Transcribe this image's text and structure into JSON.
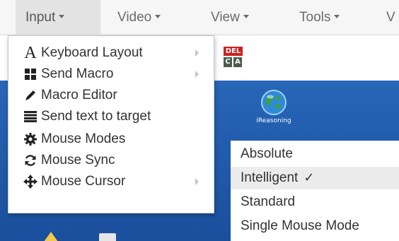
{
  "menubar": {
    "items": [
      {
        "label": "Input"
      },
      {
        "label": "Video"
      },
      {
        "label": "View"
      },
      {
        "label": "Tools"
      },
      {
        "label": "V"
      }
    ]
  },
  "input_menu": {
    "items": [
      {
        "label": "Keyboard Layout",
        "icon": "letter-a-icon",
        "has_submenu": true
      },
      {
        "label": "Send Macro",
        "icon": "grid-icon",
        "has_submenu": true
      },
      {
        "label": "Macro Editor",
        "icon": "pencil-icon",
        "has_submenu": false
      },
      {
        "label": "Send text to target",
        "icon": "list-icon",
        "has_submenu": false
      },
      {
        "label": "Mouse Modes",
        "icon": "gear-icon",
        "has_submenu": false
      },
      {
        "label": "Mouse Sync",
        "icon": "sync-icon",
        "has_submenu": false
      },
      {
        "label": "Mouse Cursor",
        "icon": "move-arrows-icon",
        "has_submenu": true
      }
    ]
  },
  "mouse_modes_submenu": {
    "items": [
      {
        "label": "Absolute",
        "selected": false
      },
      {
        "label": "Intelligent",
        "selected": true,
        "check": "✓"
      },
      {
        "label": "Standard",
        "selected": false
      },
      {
        "label": "Single Mouse Mode",
        "selected": false
      }
    ]
  },
  "desktop": {
    "cad_icon": {
      "top_label": "DEL",
      "key_c": "C",
      "key_a": "A"
    },
    "globe_icon_label": "iReasoning"
  },
  "colors": {
    "desktop_blue": "#1e5aa8",
    "menubar_bg": "#f6f6f6",
    "selected_bg": "#ececec",
    "cad_red": "#cc2020"
  }
}
